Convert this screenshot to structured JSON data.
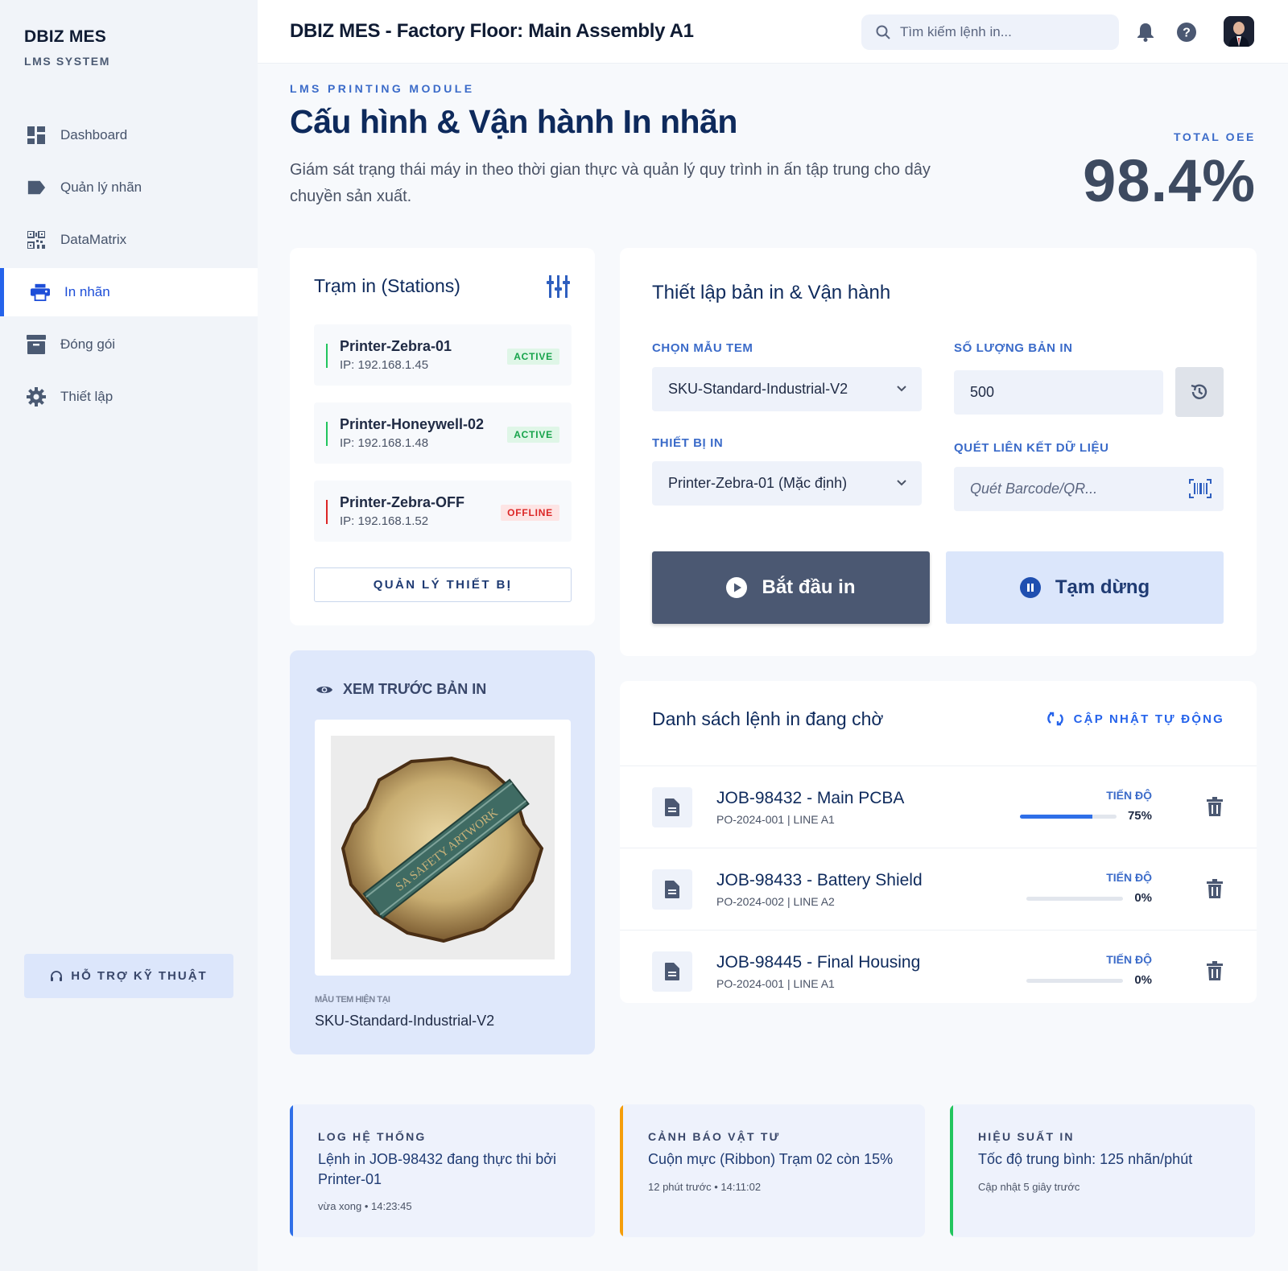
{
  "sidebar": {
    "brand": "DBIZ MES",
    "subtitle": "LMS SYSTEM",
    "items": [
      {
        "label": "Dashboard",
        "icon": "dashboard-icon"
      },
      {
        "label": "Quản lý nhãn",
        "icon": "label-icon"
      },
      {
        "label": "DataMatrix",
        "icon": "qr-code-icon"
      },
      {
        "label": "In nhãn",
        "icon": "printer-icon",
        "active": true
      },
      {
        "label": "Đóng gói",
        "icon": "archive-icon"
      },
      {
        "label": "Thiết lập",
        "icon": "gear-icon"
      }
    ],
    "support": "HỖ TRỢ KỸ THUẬT"
  },
  "header": {
    "title": "DBIZ MES - Factory Floor: Main Assembly A1",
    "search_placeholder": "Tìm kiếm lệnh in..."
  },
  "hero": {
    "eyebrow": "LMS PRINTING MODULE",
    "title": "Cấu hình & Vận hành In nhãn",
    "description": "Giám sát trạng thái máy in theo thời gian thực và quản lý quy trình in ấn tập trung cho dây chuyền sản xuất.",
    "oee_label": "TOTAL OEE",
    "oee_value": "98.4%"
  },
  "stations": {
    "title": "Trạm in (Stations)",
    "items": [
      {
        "name": "Printer-Zebra-01",
        "ip": "IP: 192.168.1.45",
        "status": "ACTIVE"
      },
      {
        "name": "Printer-Honeywell-02",
        "ip": "IP: 192.168.1.48",
        "status": "ACTIVE"
      },
      {
        "name": "Printer-Zebra-OFF",
        "ip": "IP: 192.168.1.52",
        "status": "OFFLINE"
      }
    ],
    "manage_button": "QUẢN LÝ THIẾT BỊ"
  },
  "setup": {
    "title": "Thiết lập bản in & Vận hành",
    "template_label": "CHỌN MẪU TEM",
    "template_value": "SKU-Standard-Industrial-V2",
    "quantity_label": "SỐ LƯỢNG BẢN IN",
    "quantity_value": "500",
    "device_label": "THIẾT BỊ IN",
    "device_value": "Printer-Zebra-01 (Mặc định)",
    "scan_label": "QUÉT LIÊN KẾT DỮ LIỆU",
    "scan_placeholder": "Quét Barcode/QR...",
    "start_button": "Bắt đầu in",
    "pause_button": "Tạm dừng"
  },
  "preview": {
    "title": "XEM TRƯỚC BẢN IN",
    "caption": "MẪU TEM HIỆN TẠI",
    "template": "SKU-Standard-Industrial-V2",
    "image_text": "SA SAFETY ARTWORK"
  },
  "queue": {
    "title": "Danh sách lệnh in đang chờ",
    "auto_update": "CẬP NHẬT TỰ ĐỘNG",
    "progress_label": "TIẾN ĐỘ",
    "jobs": [
      {
        "title": "JOB-98432 - Main PCBA",
        "sub": "PO-2024-001 | LINE A1",
        "progress": 75,
        "progress_text": "75%"
      },
      {
        "title": "JOB-98433 - Battery Shield",
        "sub": "PO-2024-002 | LINE A2",
        "progress": 0,
        "progress_text": "0%"
      },
      {
        "title": "JOB-98445 - Final Housing",
        "sub": "PO-2024-001 | LINE A1",
        "progress": 0,
        "progress_text": "0%"
      }
    ]
  },
  "alerts": [
    {
      "label": "LOG HỆ THỐNG",
      "text": "Lệnh in JOB-98432 đang thực thi bởi Printer-01",
      "time": "vừa xong • 14:23:45",
      "color": "#2f6fe8"
    },
    {
      "label": "CẢNH BÁO VẬT TƯ",
      "text": "Cuộn mực (Ribbon) Trạm 02 còn 15%",
      "time": "12 phút trước • 14:11:02",
      "color": "#f59e0b"
    },
    {
      "label": "HIỆU SUẤT IN",
      "text": "Tốc độ trung bình: 125 nhãn/phút",
      "time": "Cập nhật 5 giây trước",
      "color": "#22c55e"
    }
  ]
}
